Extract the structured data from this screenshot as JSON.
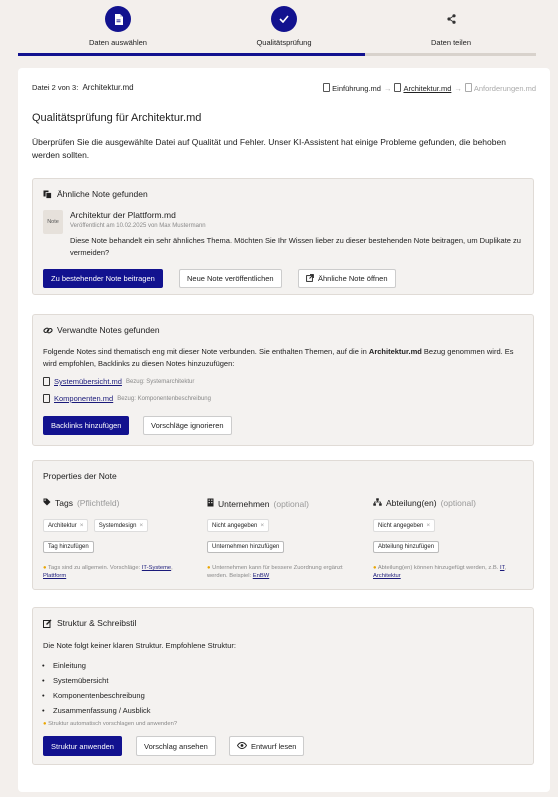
{
  "stepper": {
    "steps": [
      {
        "label": "Daten auswählen",
        "icon": "document-icon",
        "state": "active"
      },
      {
        "label": "Qualitätsprüfung",
        "icon": "checkmark-icon",
        "state": "active"
      },
      {
        "label": "Daten teilen",
        "icon": "share-icon",
        "state": "inactive"
      }
    ],
    "progress_fraction": 0.67,
    "accent": "#12128f"
  },
  "file_nav": {
    "prefix": "Datei 2 von 3:",
    "current": "Architektur.md",
    "chain": [
      "Einführung.md",
      "Architektur.md",
      "Anforderungen.md"
    ]
  },
  "page": {
    "title": "Qualitätsprüfung für Architektur.md",
    "intro": "Überprüfen Sie die ausgewählte Datei auf Qualität und Fehler. Unser KI-Assistent hat einige Probleme gefunden, die behoben werden sollten."
  },
  "similar": {
    "heading": "Ähnliche Note gefunden",
    "thumb": "Note",
    "note_title": "Architektur der Plattform.md",
    "meta": "Veröffentlicht am 10.02.2025 von Max Mustermann",
    "text": "Diese Note behandelt ein sehr ähnliches Thema. Möchten Sie Ihr Wissen lieber zu dieser bestehenden Note beitragen, um Duplikate zu vermeiden?",
    "btn_contribute": "Zu bestehender Note beitragen",
    "btn_publish": "Neue Note veröffentlichen",
    "btn_open": "Ähnliche Note öffnen"
  },
  "related": {
    "heading": "Verwandte Notes gefunden",
    "text_a": "Folgende Notes sind thematisch eng mit dieser Note verbunden. Sie enthalten Themen, auf die in ",
    "text_b": "Architektur.md",
    "text_c": " Bezug genommen wird. Es wird empfohlen, Backlinks zu diesen Notes hinzuzufügen:",
    "items": [
      {
        "name": "Systemübersicht.md",
        "ref": "Bezug: Systemarchitektur"
      },
      {
        "name": "Komponenten.md",
        "ref": "Bezug: Komponentenbeschreibung"
      }
    ],
    "btn_backlinks": "Backlinks hinzufügen",
    "btn_ignore": "Vorschläge ignorieren"
  },
  "properties": {
    "heading": "Properties der Note",
    "tags": {
      "title": "Tags",
      "note": "(Pflichtfeld)",
      "chips": [
        "Architektur",
        "Systemdesign"
      ],
      "add": "Tag hinzufügen",
      "hint_a": "Tags sind zu allgemein. Vorschläge: ",
      "hint_links": [
        "IT-Systeme",
        "Plattform"
      ],
      "hint_sep": ", "
    },
    "company": {
      "title": "Unternehmen",
      "note": "(optional)",
      "chip": "Nicht angegeben",
      "add": "Unternehmen hinzufügen",
      "hint_a": "Unternehmen kann für bessere Zuordnung ergänzt werden. Beispiel: ",
      "hint_link": "EnBW"
    },
    "dept": {
      "title": "Abteilung(en)",
      "note": "(optional)",
      "chip": "Nicht angegeben",
      "add": "Abteilung hinzufügen",
      "hint_a": "Abteilung(en) können hinzugefügt werden, z.B. ",
      "hint_links": [
        "IT",
        "Architektur"
      ],
      "hint_sep": ", "
    }
  },
  "structure": {
    "heading": "Struktur & Schreibstil",
    "text": "Die Note folgt keiner klaren Struktur. Empfohlene Struktur:",
    "items": [
      "Einleitung",
      "Systemübersicht",
      "Komponentenbeschreibung",
      "Zusammenfassung / Ausblick"
    ],
    "hint": "Struktur automatisch vorschlagen und anwenden?",
    "btn_apply": "Struktur anwenden",
    "btn_view": "Vorschlag ansehen",
    "btn_read": "Entwurf lesen"
  }
}
